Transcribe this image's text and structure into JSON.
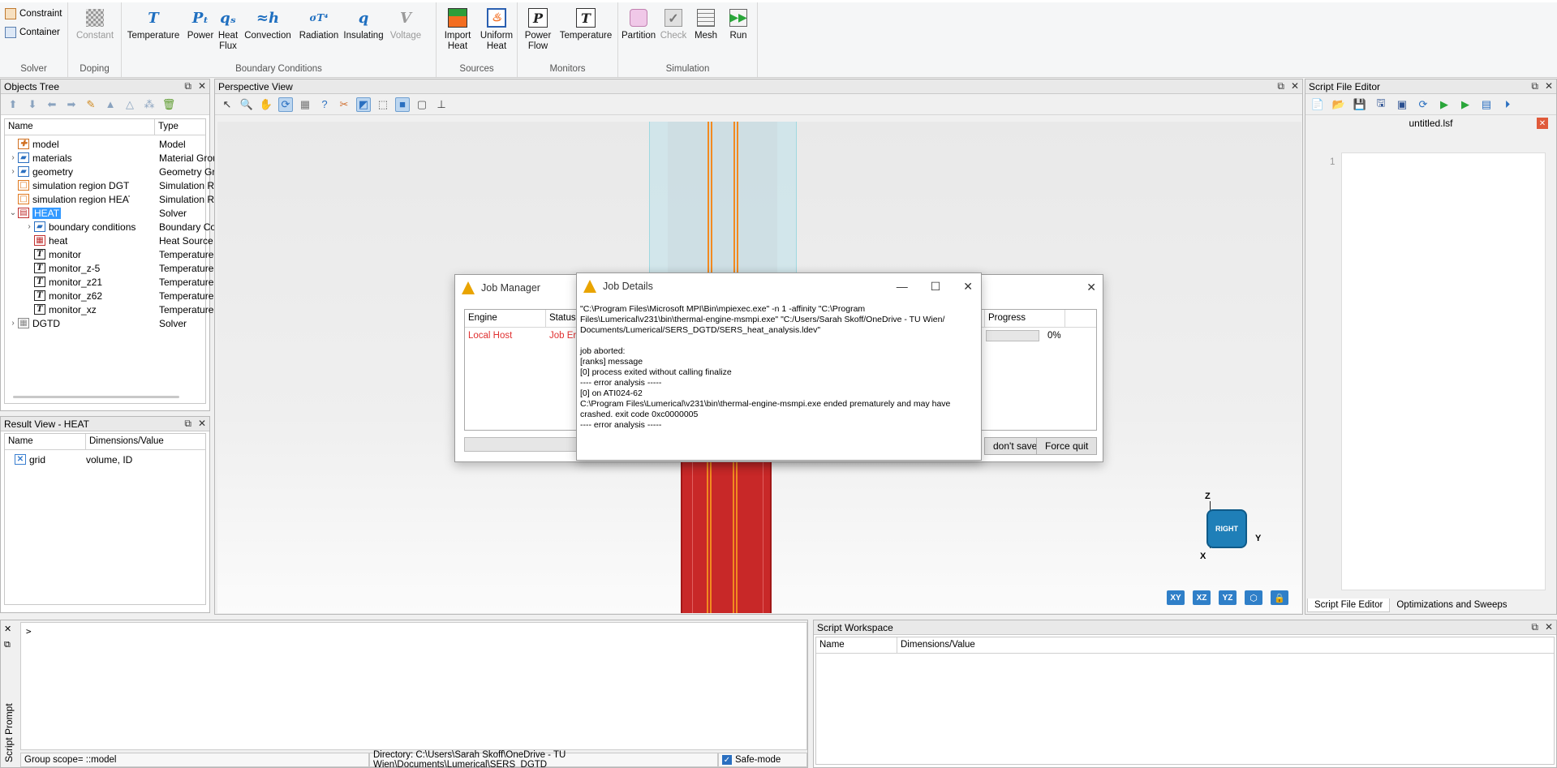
{
  "ribbon": {
    "solver": {
      "label": "Solver",
      "constraint": "Constraint",
      "container": "Container"
    },
    "doping": {
      "label": "Doping",
      "constant": "Constant"
    },
    "boundary": {
      "label": "Boundary Conditions",
      "items": [
        {
          "label": "Temperature",
          "icon": "temperature-icon",
          "glyph": "T"
        },
        {
          "label": "Power",
          "icon": "power-icon",
          "glyph": "Pₜ"
        },
        {
          "label": "Heat\nFlux",
          "icon": "heat-flux-icon",
          "glyph": "qₛ"
        },
        {
          "label": "Convection",
          "icon": "convection-icon",
          "glyph": "≈h"
        },
        {
          "label": "Radiation",
          "icon": "radiation-icon",
          "glyph": "σT⁴"
        },
        {
          "label": "Insulating",
          "icon": "insulating-icon",
          "glyph": "q"
        },
        {
          "label": "Voltage",
          "icon": "voltage-icon",
          "glyph": "V"
        }
      ]
    },
    "sources": {
      "label": "Sources",
      "import_heat": "Import\nHeat",
      "uniform_heat": "Uniform\nHeat"
    },
    "monitors": {
      "label": "Monitors",
      "power_flow": "Power\nFlow",
      "temperature": "Temperature"
    },
    "simulation": {
      "label": "Simulation",
      "partition": "Partition",
      "check": "Check",
      "mesh": "Mesh",
      "run": "Run"
    }
  },
  "objects_tree": {
    "title": "Objects Tree",
    "col_name": "Name",
    "col_type": "Type",
    "rows": [
      {
        "name": "model",
        "type": "Model"
      },
      {
        "name": "materials",
        "type": "Material Grou"
      },
      {
        "name": "geometry",
        "type": "Geometry Gro"
      },
      {
        "name": "simulation region DGTD",
        "type": "Simulation Re"
      },
      {
        "name": "simulation region HEAT",
        "type": "Simulation Re"
      },
      {
        "name": "HEAT",
        "type": "Solver"
      },
      {
        "name": "boundary conditions",
        "type": "Boundary Co"
      },
      {
        "name": "heat",
        "type": "Heat Source"
      },
      {
        "name": "monitor",
        "type": "Temperature"
      },
      {
        "name": "monitor_z-5",
        "type": "Temperature"
      },
      {
        "name": "monitor_z21",
        "type": "Temperature"
      },
      {
        "name": "monitor_z62",
        "type": "Temperature"
      },
      {
        "name": "monitor_xz",
        "type": "Temperature"
      },
      {
        "name": "DGTD",
        "type": "Solver"
      }
    ]
  },
  "result_view": {
    "title": "Result View - HEAT",
    "col_name": "Name",
    "col_dims": "Dimensions/Value",
    "rows": [
      {
        "name": "grid",
        "value": "volume, ID"
      }
    ]
  },
  "perspective": {
    "title": "Perspective View",
    "cube_label": "RIGHT",
    "axes": {
      "z": "Z",
      "y": "Y",
      "x": "X"
    },
    "view_buttons": [
      "XY",
      "XZ",
      "YZ"
    ]
  },
  "script_editor": {
    "title": "Script File Editor",
    "file_tab": "untitled.lsf",
    "line_number": "1",
    "tabs": [
      "Script File Editor",
      "Optimizations and Sweeps"
    ]
  },
  "job_manager": {
    "title": "Job Manager",
    "cols": {
      "engine": "Engine",
      "status": "Status",
      "progress": "Progress"
    },
    "row": {
      "engine": "Local Host",
      "status": "Job Err",
      "progress": "0%"
    },
    "dont_save": "don't save",
    "force_quit": "Force quit"
  },
  "job_details": {
    "title": "Job Details",
    "lines": [
      "\"C:\\Program Files\\Microsoft MPI\\Bin\\mpiexec.exe\" -n 1 -affinity \"C:\\Program",
      "Files\\Lumerical\\v231\\bin\\thermal-engine-msmpi.exe\" \"C:/Users/Sarah Skoff/OneDrive - TU Wien/",
      "Documents/Lumerical/SERS_DGTD/SERS_heat_analysis.ldev\"",
      "",
      "job aborted:",
      "[ranks] message",
      "[0] process exited without calling finalize",
      "---- error analysis -----",
      "[0] on ATI024-62",
      "C:\\Program Files\\Lumerical\\v231\\bin\\thermal-engine-msmpi.exe ended prematurely and may have",
      "crashed. exit code 0xc0000005",
      "---- error analysis -----"
    ]
  },
  "script_prompt": {
    "title": "Script Prompt",
    "prompt": ">",
    "group_scope": "Group scope= ::model",
    "directory": "Directory: C:\\Users\\Sarah Skoff\\OneDrive - TU Wien\\Documents\\Lumerical\\SERS_DGTD",
    "safe_mode": "Safe-mode"
  },
  "script_workspace": {
    "title": "Script Workspace",
    "col_name": "Name",
    "col_dims": "Dimensions/Value"
  }
}
